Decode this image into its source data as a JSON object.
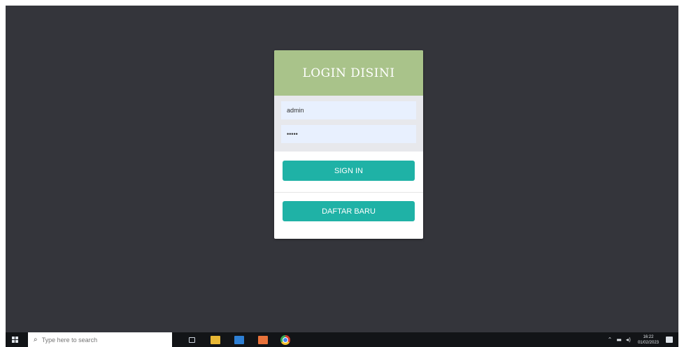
{
  "login": {
    "title": "LOGIN DISINI",
    "username_value": "admin",
    "password_value": "•••••",
    "signin_label": "SIGN IN",
    "daftar_label": "DAFTAR BARU"
  },
  "taskbar": {
    "search_placeholder": "Type here to search",
    "clock_time": "16:22",
    "clock_date": "01/02/2023",
    "icons": [
      "windows-start-icon",
      "search-icon",
      "task-view-icon",
      "file-explorer-icon",
      "store-icon",
      "office-icon",
      "chrome-icon"
    ],
    "tray_icons": [
      "chevron-up-icon",
      "network-icon",
      "volume-icon",
      "notification-icon"
    ]
  },
  "colors": {
    "background": "#34353b",
    "header": "#a9c38a",
    "button": "#1fb2a6",
    "fields_panel": "#e7e8ec",
    "taskbar": "#121417"
  }
}
